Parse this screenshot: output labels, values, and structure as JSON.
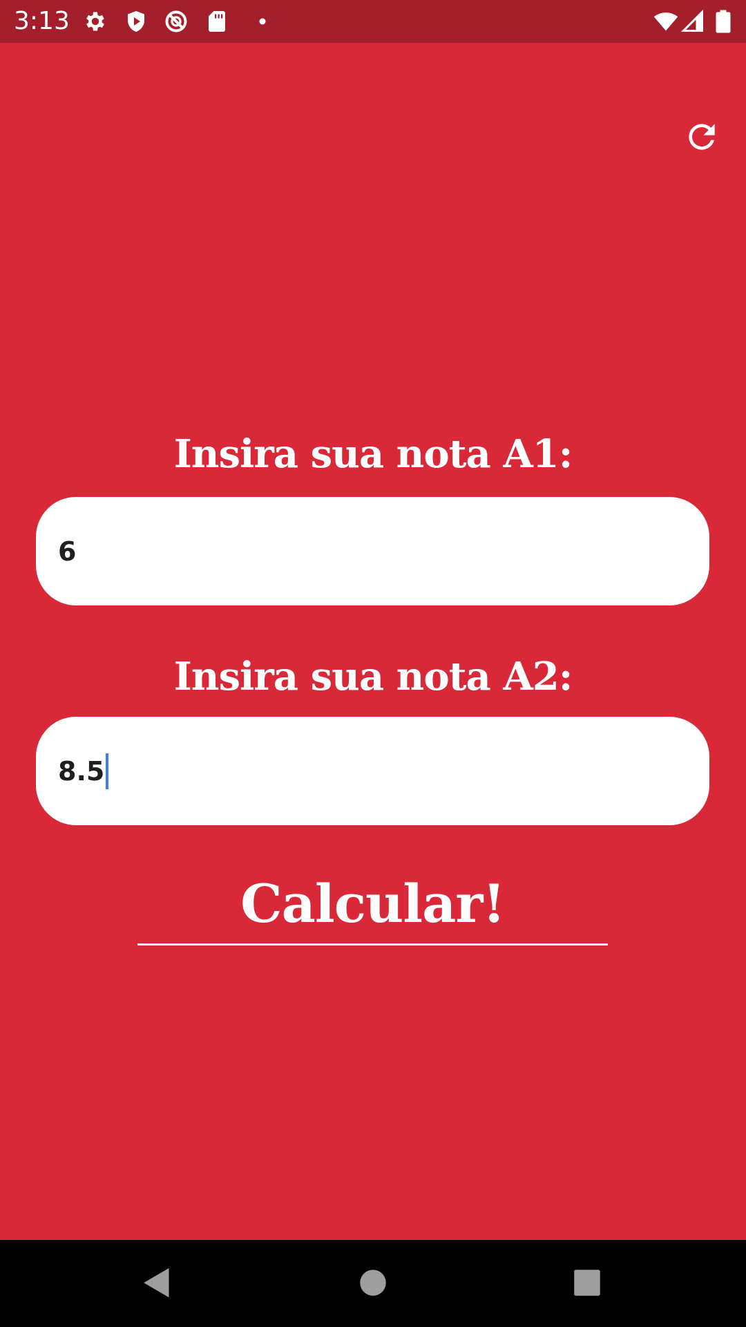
{
  "status_bar": {
    "time": "3:13",
    "left_icons": [
      "gear-icon",
      "shield-play-icon",
      "circle-slash-icon",
      "sd-card-icon",
      "dot-icon"
    ],
    "right_icons": [
      "wifi-icon",
      "signal-icon",
      "battery-icon"
    ],
    "background": "#a31f2b"
  },
  "app": {
    "background": "#d92837",
    "refresh_icon": "refresh-icon",
    "label_a1": "Insira sua nota A1:",
    "input_a1_value": "6",
    "label_a2": "Insira sua nota A2:",
    "input_a2_value": "8.5",
    "calculate_label": "Calcular!"
  },
  "nav_bar": {
    "buttons": [
      "back-icon",
      "home-icon",
      "recents-icon"
    ]
  }
}
